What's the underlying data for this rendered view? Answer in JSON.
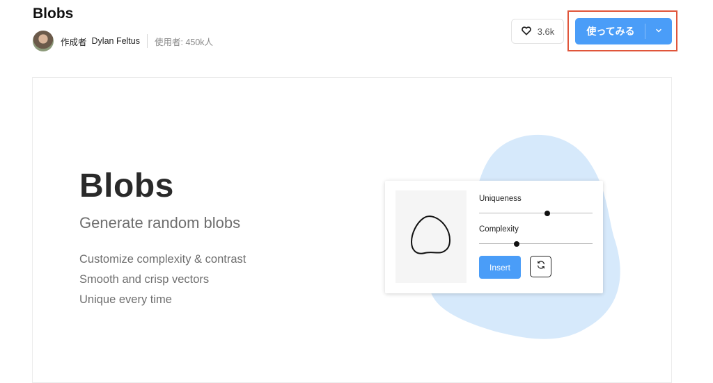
{
  "header": {
    "title": "Blobs",
    "author_prefix": "作成者",
    "author_name": "Dylan Feltus",
    "users": "使用者: 450k人",
    "likes": "3.6k",
    "try_button": "使ってみる"
  },
  "preview": {
    "title": "Blobs",
    "subtitle": "Generate random blobs",
    "features": [
      "Customize complexity & contrast",
      "Smooth and crisp vectors",
      "Unique every time"
    ],
    "plugin": {
      "uniqueness_label": "Uniqueness",
      "uniqueness_value": 0.6,
      "complexity_label": "Complexity",
      "complexity_value": 0.33,
      "insert_label": "Insert"
    }
  },
  "colors": {
    "accent": "#4a9df8",
    "highlight_border": "#e0553a",
    "blob_background": "#d6e9fb"
  },
  "icons": {
    "like": "heart-icon",
    "dropdown": "chevron-down-icon",
    "refresh": "refresh-icon"
  }
}
